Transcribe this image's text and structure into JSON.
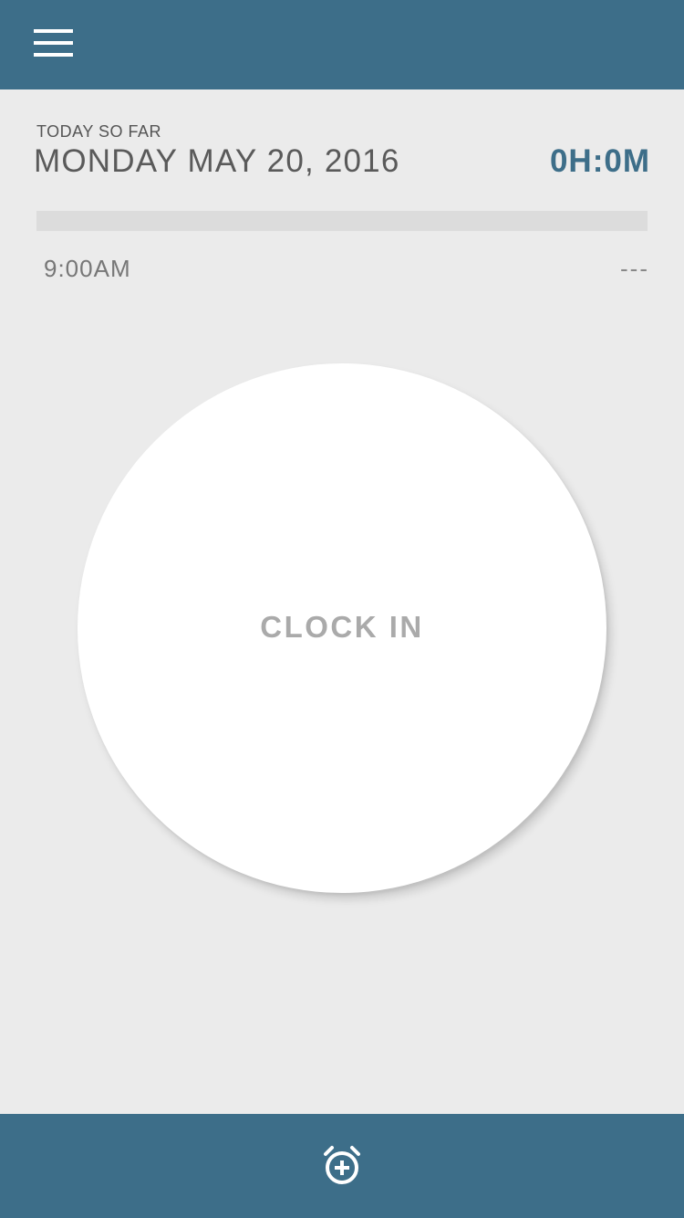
{
  "header": {
    "menu_icon": "hamburger-menu-icon",
    "background_color": "#3d6e89"
  },
  "summary": {
    "caption": "TODAY SO FAR",
    "date": "MONDAY MAY 20, 2016",
    "total": "0H:0M",
    "accent_color": "#3d6e89"
  },
  "progress": {
    "value": 0,
    "start_time": "9:00AM",
    "end_time": "---"
  },
  "clock": {
    "label": "CLOCK IN"
  },
  "footer": {
    "alarm_icon": "add-alarm-icon"
  }
}
